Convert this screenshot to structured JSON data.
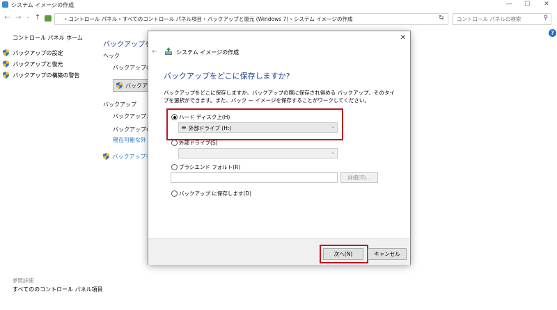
{
  "window": {
    "title": "システム イメージの作成",
    "minimize": "—",
    "maximize": "☐",
    "close": "✕"
  },
  "nav": {
    "back": "←",
    "forward": "→",
    "recent": "⌄",
    "up": "↑",
    "breadcrumb": "›  コントロール パネル  ›  すべてのコントロール パネル項目  ›  バックアップと復元 (Windows 7)  ›  システム イメージの作成",
    "address_dropdown": "⌄",
    "refresh": "↻",
    "search_placeholder": "コントロール パネルの検索",
    "search_icon": "⚲"
  },
  "sidebar": {
    "home": "コントロール パネル ホーム",
    "items": [
      {
        "label": "バックアップの設定"
      },
      {
        "label": "バックアップと復元"
      },
      {
        "label": "バックアップの構築の警告"
      }
    ],
    "see_also_header": "参照詳細",
    "see_also_items": [
      {
        "label": "すべてののコントロール パネル項目"
      }
    ]
  },
  "background": {
    "heading": "バックアップをど",
    "section1": "ヘック",
    "line1": "バックアップのカ",
    "button1": "バックア",
    "section2": "バックアップ",
    "line2": "バックアップ：：",
    "line3": "バックアップの圧",
    "line4": "現在可能な外",
    "link": "バックアップを復"
  },
  "dialog": {
    "title": "システム イメージの作成",
    "heading": "バックアップをどこに保存しますか?",
    "description": "バックアップをどこに保存しますか、バックアップの際に保存され得める バックアップ、そのタイプを選択ができます。また、バック — イメージを保存することがワークしてください。",
    "options": [
      {
        "label": "ハード ディスク上(H)",
        "selected": true
      },
      {
        "label": "外部ドライブ(S)",
        "selected": false
      },
      {
        "label": "ブラシエンド フォルト(R)",
        "selected": false
      },
      {
        "label": "バックアップ に保存します(D)",
        "selected": false
      }
    ],
    "hard_disk_value": "外部ドライブ (H:)",
    "browse_label": "詳細(B)...",
    "next_label": "次へ(N)",
    "cancel_label": "キャンセル"
  },
  "colors": {
    "highlight": "#c0141c",
    "heading_blue": "#1e3f91",
    "link_blue": "#1a6fc2"
  }
}
